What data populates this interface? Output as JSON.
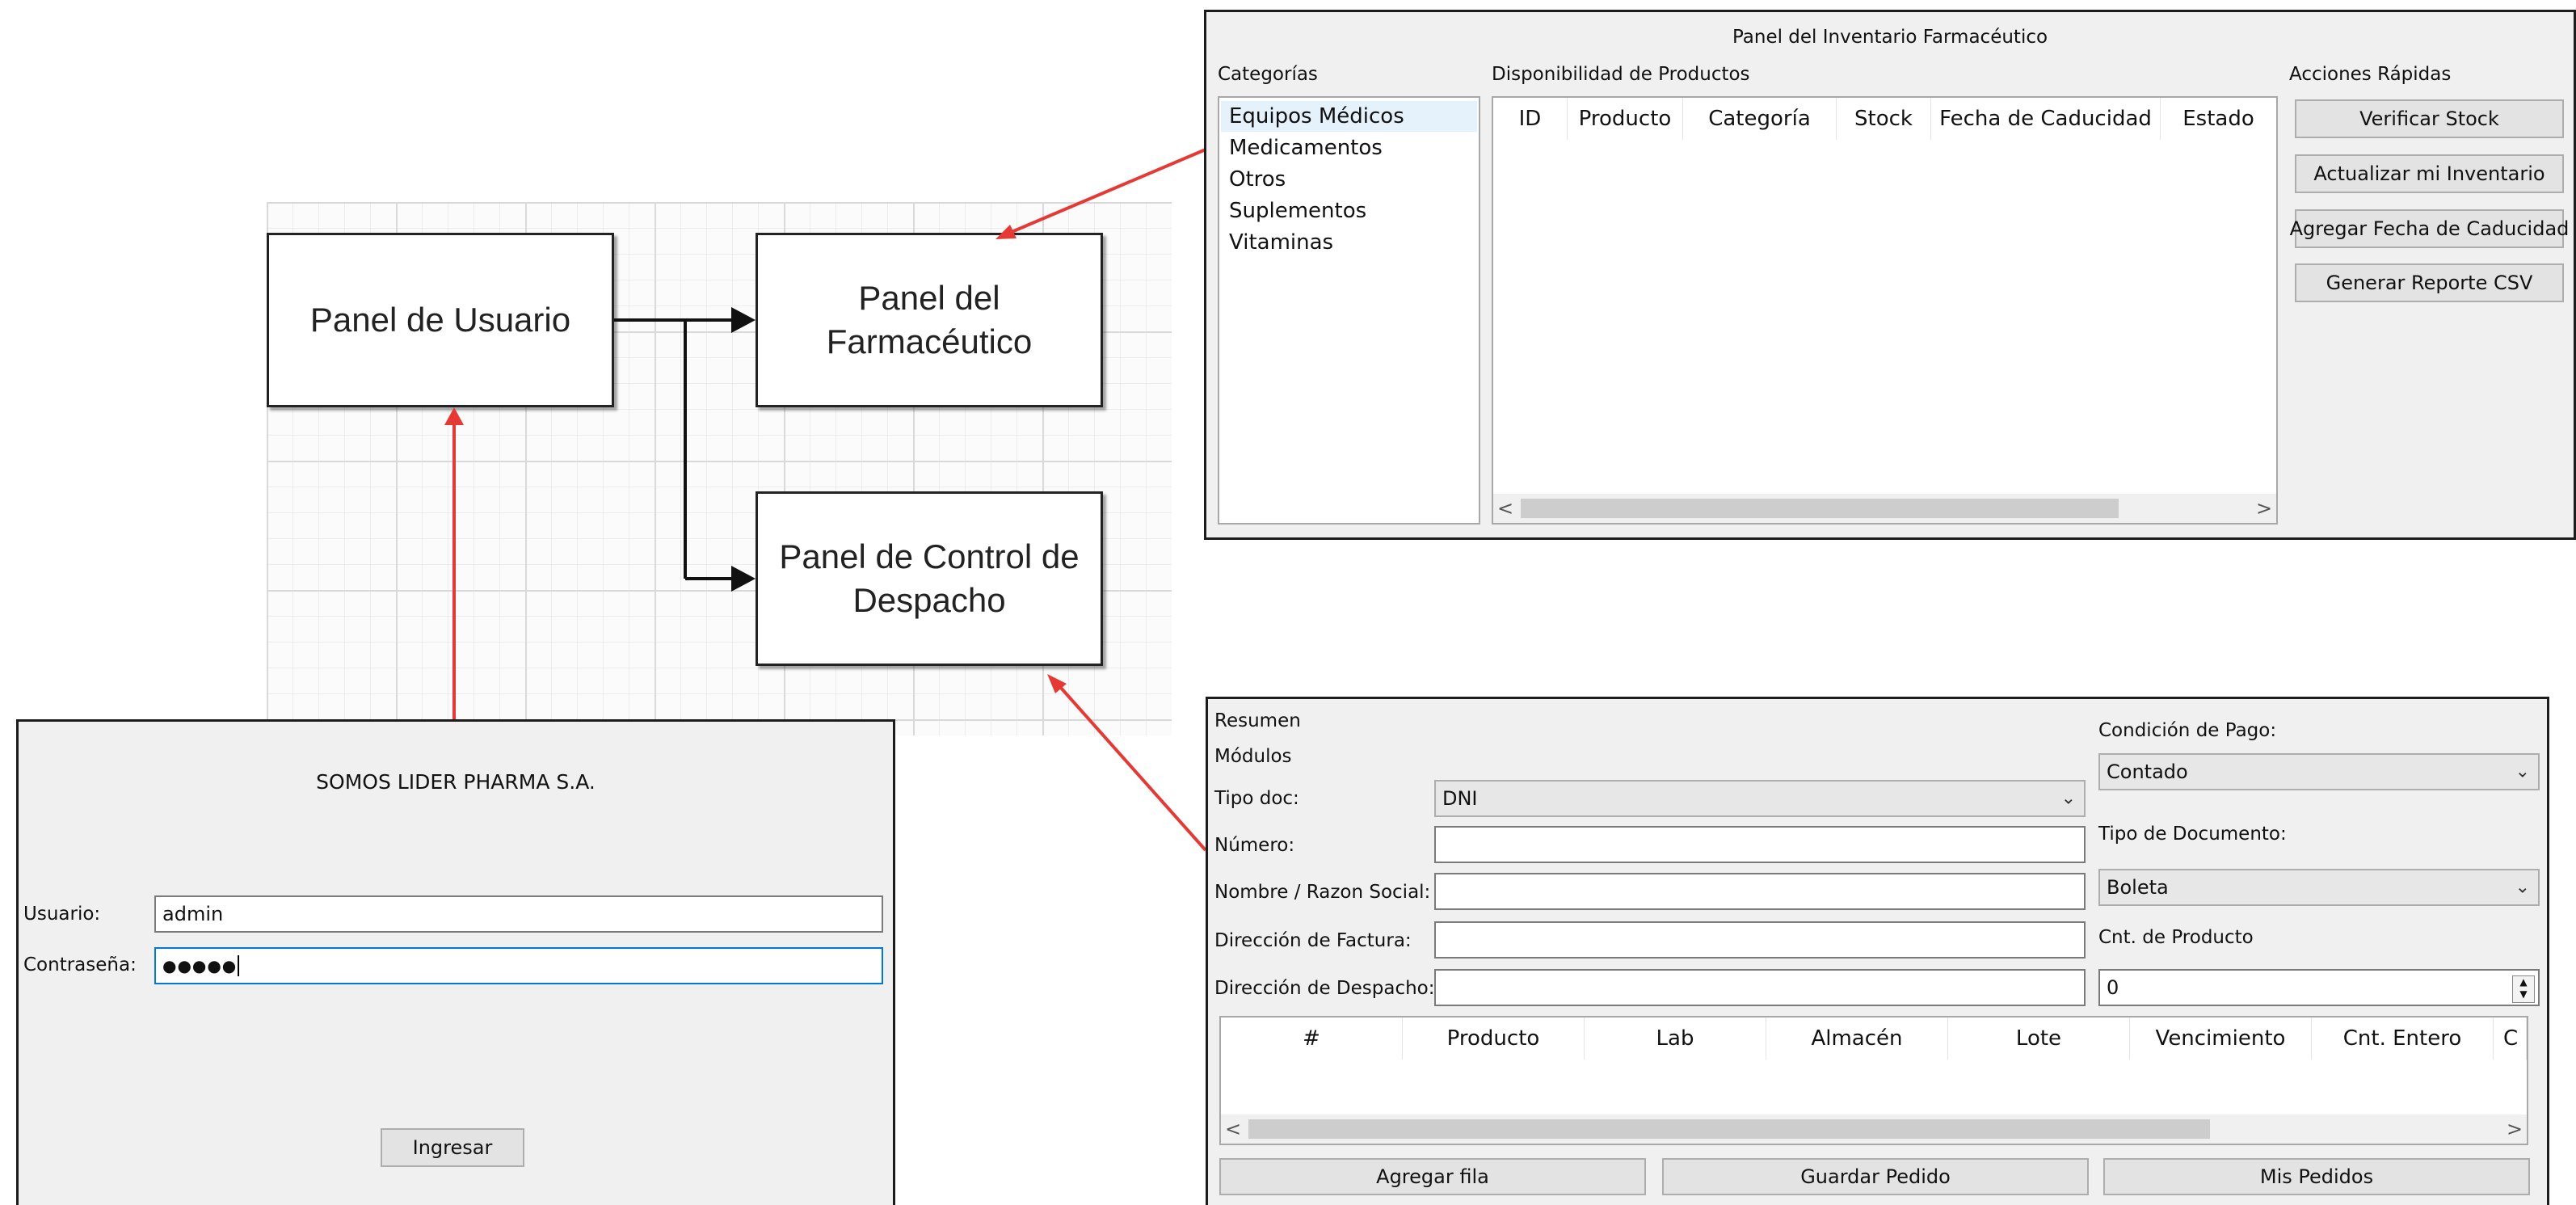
{
  "diagram": {
    "user_panel": "Panel de Usuario",
    "pharmacist_panel": [
      "Panel del",
      "Farmacéutico"
    ],
    "dispatch_panel": [
      "Panel de Control de",
      "Despacho"
    ],
    "arrow_color": "#e53935"
  },
  "login": {
    "company": "SOMOS LIDER PHARMA S.A.",
    "user_label": "Usuario:",
    "user_value": "admin",
    "password_label": "Contraseña:",
    "password_value": "●●●●●",
    "submit_label": "Ingresar"
  },
  "inventory": {
    "title": "Panel del Inventario Farmacéutico",
    "categories_title": "Categorías",
    "categories": [
      "Equipos Médicos",
      "Medicamentos",
      "Otros",
      "Suplementos",
      "Vitaminas"
    ],
    "selected_category": "Equipos Médicos",
    "products_title": "Disponibilidad de Productos",
    "columns": [
      "ID",
      "Producto",
      "Categoría",
      "Stock",
      "Fecha de Caducidad",
      "Estado"
    ],
    "actions_title": "Acciones Rápidas",
    "actions": [
      "Verificar Stock",
      "Actualizar mi Inventario",
      "Agregar Fecha de Caducidad",
      "Generar Reporte CSV"
    ],
    "scroll_left": "<",
    "scroll_right": ">"
  },
  "dispatch": {
    "summary_label": "Resumen",
    "modules_label": "Módulos",
    "doc_type_label": "Tipo doc:",
    "doc_type_value": "DNI",
    "number_label": "Número:",
    "name_label": "Nombre / Razon Social:",
    "invoice_address_label": "Dirección de Factura:",
    "dispatch_address_label": "Dirección de Despacho:",
    "payment_condition_label": "Condición de Pago:",
    "payment_condition_value": "Contado",
    "document_type_label": "Tipo de Documento:",
    "document_type_value": "Boleta",
    "product_qty_label": "Cnt. de Producto",
    "product_qty_value": "0",
    "columns": [
      "#",
      "Producto",
      "Lab",
      "Almacén",
      "Lote",
      "Vencimiento",
      "Cnt. Entero",
      "C"
    ],
    "add_row_label": "Agregar fila",
    "save_order_label": "Guardar Pedido",
    "my_orders_label": "Mis Pedidos",
    "scroll_left": "<",
    "scroll_right": ">"
  }
}
